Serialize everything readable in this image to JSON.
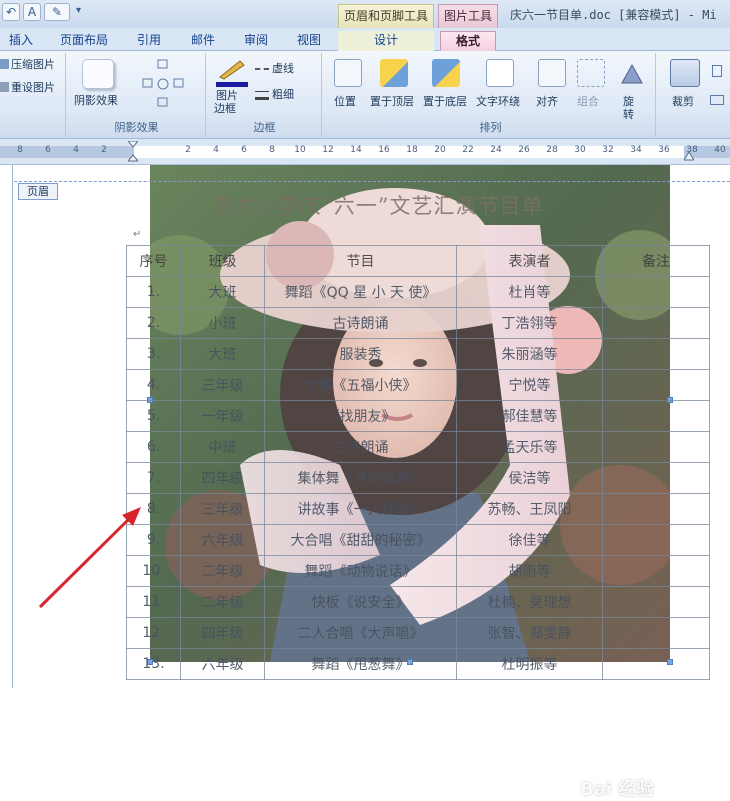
{
  "title_bar": {
    "context_tab_header_footer": "页眉和页脚工具",
    "context_tab_picture": "图片工具",
    "doc_title": "庆六一节目单.doc [兼容模式] - Mi"
  },
  "tabs": [
    {
      "label": "插入"
    },
    {
      "label": "页面布局"
    },
    {
      "label": "引用"
    },
    {
      "label": "邮件"
    },
    {
      "label": "审阅"
    },
    {
      "label": "视图"
    },
    {
      "label": "设计"
    },
    {
      "label": "格式"
    }
  ],
  "ribbon": {
    "adjust": {
      "compress": "压缩图片",
      "reset": "重设图片"
    },
    "shadow": {
      "shadow_effect": "阴影效果",
      "group_label": "阴影效果"
    },
    "border": {
      "picture_border_line1": "图片",
      "picture_border_line2": "边框",
      "dash": "虚线",
      "weight": "粗细",
      "group_label": "边框"
    },
    "arrange": {
      "position": "位置",
      "bring_front": "置于顶层",
      "send_back": "置于底层",
      "wrap_text": "文字环绕",
      "align": "对齐",
      "group": "组合",
      "rotate": "旋转",
      "group_label": "排列"
    },
    "size": {
      "crop": "裁剪"
    }
  },
  "ruler": {
    "ticks": [
      "8",
      "6",
      "4",
      "2",
      "2",
      "4",
      "6",
      "8",
      "10",
      "12",
      "14",
      "16",
      "18",
      "20",
      "22",
      "24",
      "26",
      "28",
      "30",
      "32",
      "34",
      "36",
      "38",
      "40",
      "42"
    ]
  },
  "document": {
    "header_label": "页眉",
    "heading": "育才小学庆“六一”文艺汇演节目单",
    "table": {
      "columns": [
        "序号",
        "班级",
        "节目",
        "表演者",
        "备注"
      ],
      "rows": [
        [
          "1.",
          "大班",
          "舞蹈《QQ 星 小 天 使》",
          "杜肖等",
          ""
        ],
        [
          "2.",
          "小班",
          "古诗朗诵",
          "丁浩翎等",
          ""
        ],
        [
          "3.",
          "大班",
          "服装秀",
          "朱丽涵等",
          ""
        ],
        [
          "4.",
          "三年级",
          "合唱《五福小侠》",
          "宁悦等",
          ""
        ],
        [
          "5.",
          "一年级",
          "《找朋友》",
          "郝佳慧等",
          ""
        ],
        [
          "6.",
          "中班",
          "古诗朗诵",
          "孟天乐等",
          ""
        ],
        [
          "7.",
          "四年级",
          "集体舞《寻胡隐君》",
          "侯洁等",
          ""
        ],
        [
          "8.",
          "三年级",
          "讲故事《一人性缓》",
          "苏畅、王凤阳",
          ""
        ],
        [
          "9.",
          "六年级",
          "大合唱《甜甜的秘密》",
          "徐佳等",
          ""
        ],
        [
          "10.",
          "二年级",
          "舞蹈《动物说话》",
          "胡雨等",
          ""
        ],
        [
          "11.",
          "二年级",
          "快板《说安全》",
          "杜楠、吴理想",
          ""
        ],
        [
          "12.",
          "四年级",
          "二人合唱《大声唱》",
          "张智、郑雯静",
          ""
        ],
        [
          "13.",
          "六年级",
          "舞蹈《甩葱舞》",
          "杜明振等",
          ""
        ]
      ]
    },
    "watermark": "Bai 经验"
  },
  "colors": {
    "arrow": "#d7262b",
    "active_tab": "#f5cfe0",
    "ribbon": "#dde8f6"
  }
}
